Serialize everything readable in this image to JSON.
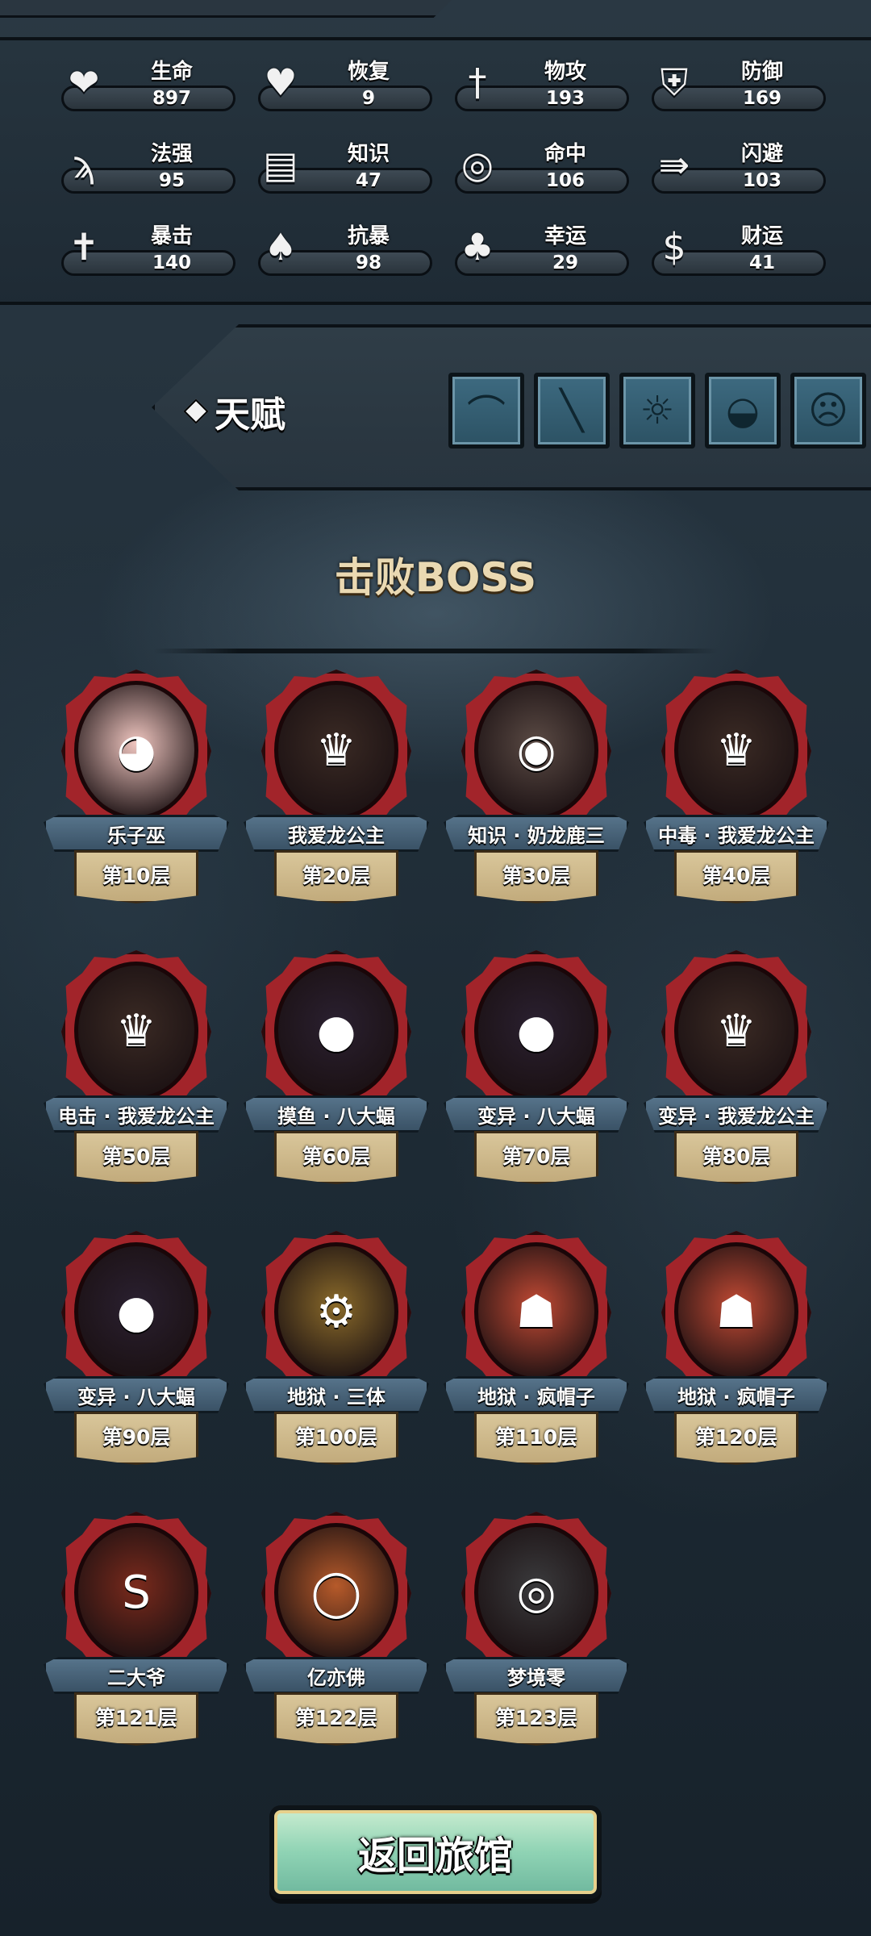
{
  "stats": [
    {
      "name": "生命",
      "value": "897",
      "icon": "heart-icon",
      "glyph": "❤"
    },
    {
      "name": "恢复",
      "value": "9",
      "icon": "heal-heart-icon",
      "glyph": "♥"
    },
    {
      "name": "物攻",
      "value": "193",
      "icon": "sword-icon",
      "glyph": "†"
    },
    {
      "name": "防御",
      "value": "169",
      "icon": "armor-icon",
      "glyph": "⛨"
    },
    {
      "name": "法强",
      "value": "95",
      "icon": "staff-icon",
      "glyph": "ϡ"
    },
    {
      "name": "知识",
      "value": "47",
      "icon": "book-icon",
      "glyph": "▤"
    },
    {
      "name": "命中",
      "value": "106",
      "icon": "target-icon",
      "glyph": "◎"
    },
    {
      "name": "闪避",
      "value": "103",
      "icon": "dodge-arrows-icon",
      "glyph": "⇛"
    },
    {
      "name": "暴击",
      "value": "140",
      "icon": "crit-sword-icon",
      "glyph": "✝"
    },
    {
      "name": "抗暴",
      "value": "98",
      "icon": "shield-leaf-icon",
      "glyph": "♠"
    },
    {
      "name": "幸运",
      "value": "29",
      "icon": "clover-icon",
      "glyph": "♣"
    },
    {
      "name": "财运",
      "value": "41",
      "icon": "coin-icon",
      "glyph": "$"
    }
  ],
  "talent": {
    "label": "天赋",
    "slots": [
      {
        "icon": "witch-hat-icon",
        "glyph": "⌒"
      },
      {
        "icon": "wand-icon",
        "glyph": "╲"
      },
      {
        "icon": "tower-eye-icon",
        "glyph": "☼"
      },
      {
        "icon": "helmet-icon",
        "glyph": "◒"
      },
      {
        "icon": "demon-face-icon",
        "glyph": "☹"
      }
    ]
  },
  "section_title": "击败BOSS",
  "bosses": [
    {
      "name": "乐子巫",
      "floor": "第10层",
      "color": "#f0c6c0",
      "glyph": "◕"
    },
    {
      "name": "我爱龙公主",
      "floor": "第20层",
      "color": "#3a2a24",
      "glyph": "♛"
    },
    {
      "name": "知识 · 奶龙鹿三",
      "floor": "第30层",
      "color": "#5a4a44",
      "glyph": "◉"
    },
    {
      "name": "中毒 · 我爱龙公主",
      "floor": "第40层",
      "color": "#3a2a24",
      "glyph": "♛"
    },
    {
      "name": "电击 · 我爱龙公主",
      "floor": "第50层",
      "color": "#3a2a24",
      "glyph": "♛"
    },
    {
      "name": "摸鱼 · 八大蝠",
      "floor": "第60层",
      "color": "#2a2030",
      "glyph": "●"
    },
    {
      "name": "变异 · 八大蝠",
      "floor": "第70层",
      "color": "#2a2030",
      "glyph": "●"
    },
    {
      "name": "变异 · 我爱龙公主",
      "floor": "第80层",
      "color": "#3a2a24",
      "glyph": "♛"
    },
    {
      "name": "变异 · 八大蝠",
      "floor": "第90层",
      "color": "#2a2030",
      "glyph": "●"
    },
    {
      "name": "地狱 · 三体",
      "floor": "第100层",
      "color": "#8a6a2a",
      "glyph": "⚙"
    },
    {
      "name": "地狱 · 疯帽子",
      "floor": "第110层",
      "color": "#c24a34",
      "glyph": "☗"
    },
    {
      "name": "地狱 · 疯帽子",
      "floor": "第120层",
      "color": "#c24a34",
      "glyph": "☗"
    },
    {
      "name": "二大爷",
      "floor": "第121层",
      "color": "#7a2a1c",
      "glyph": "S"
    },
    {
      "name": "亿亦佛",
      "floor": "第122层",
      "color": "#b65a2a",
      "glyph": "◯"
    },
    {
      "name": "梦境零",
      "floor": "第123层",
      "color": "#3a3a3c",
      "glyph": "◎"
    }
  ],
  "return_button": "返回旅馆"
}
